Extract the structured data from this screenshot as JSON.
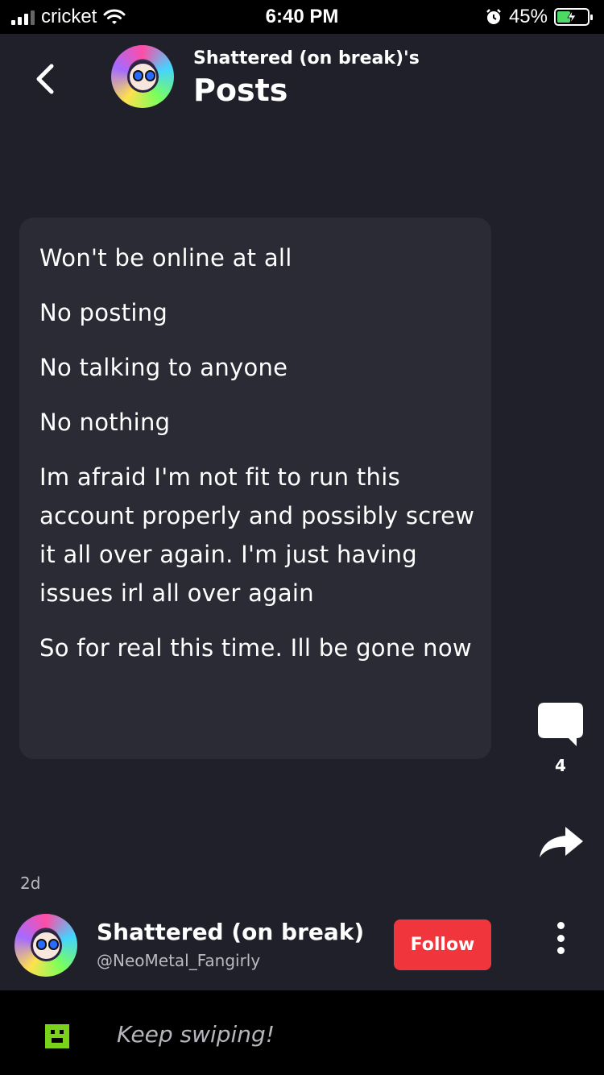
{
  "status_bar": {
    "carrier": "cricket",
    "time": "6:40 PM",
    "battery_percent": "45%",
    "battery_level": 0.45
  },
  "header": {
    "subtitle": "Shattered (on break)'s",
    "title": "Posts"
  },
  "post": {
    "paragraphs": [
      "Won't be online at all",
      "No posting",
      "No talking to anyone",
      "No nothing",
      "Im afraid I'm not fit to run this account properly and possibly screw it all over again. I'm just having issues irl all over again",
      "So for real this time. Ill be gone now"
    ],
    "time_ago": "2d"
  },
  "actions": {
    "comment_count": "4"
  },
  "author": {
    "name": "Shattered (on break)",
    "handle": "@NeoMetal_Fangirly",
    "follow_label": "Follow"
  },
  "bottom_bar": {
    "text": "Keep swiping!"
  },
  "colors": {
    "background": "#1f2029",
    "card": "#2a2b35",
    "follow": "#f0353c",
    "accent_icon": "#7ad21b"
  }
}
